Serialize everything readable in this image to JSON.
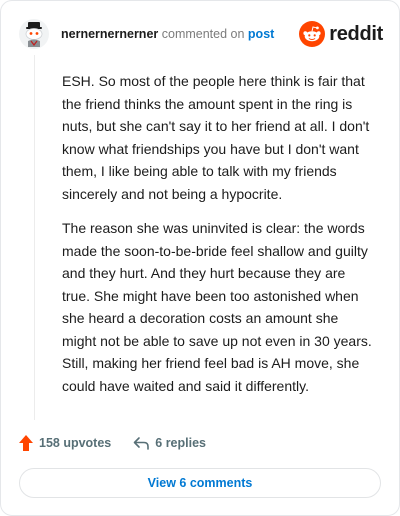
{
  "header": {
    "username": "nernernernerner",
    "action_text": "commented on",
    "post_link": "post",
    "brand_name": "reddit"
  },
  "comment": {
    "paragraphs": [
      "ESH. So most of the people here think is fair that the friend thinks the amount spent in the ring is nuts, but she can't say it to her friend at all. I don't know what friendships you have but I don't want them, I like being able to talk with my friends sincerely and not being a hypocrite.",
      "The reason she was uninvited is clear: the words made the soon-to-be-bride feel shallow and guilty and they hurt. And they hurt because they are true. She might have been too astonished when she heard a decoration costs an amount she might not be able to save up not even in 30 years. Still, making her friend feel bad is AH move, she could have waited and said it differently."
    ]
  },
  "actions": {
    "upvotes": "158 upvotes",
    "replies": "6 replies",
    "view_comments": "View 6 comments"
  },
  "colors": {
    "brand": "#ff4500",
    "link": "#0079d3",
    "upvote_icon": "#ff4500",
    "meta_text": "#576f76"
  },
  "icons": {
    "avatar": "snoo-avatar-icon",
    "logo": "reddit-logo-icon",
    "upvote": "upvote-arrow-icon",
    "reply": "reply-arrow-icon"
  }
}
